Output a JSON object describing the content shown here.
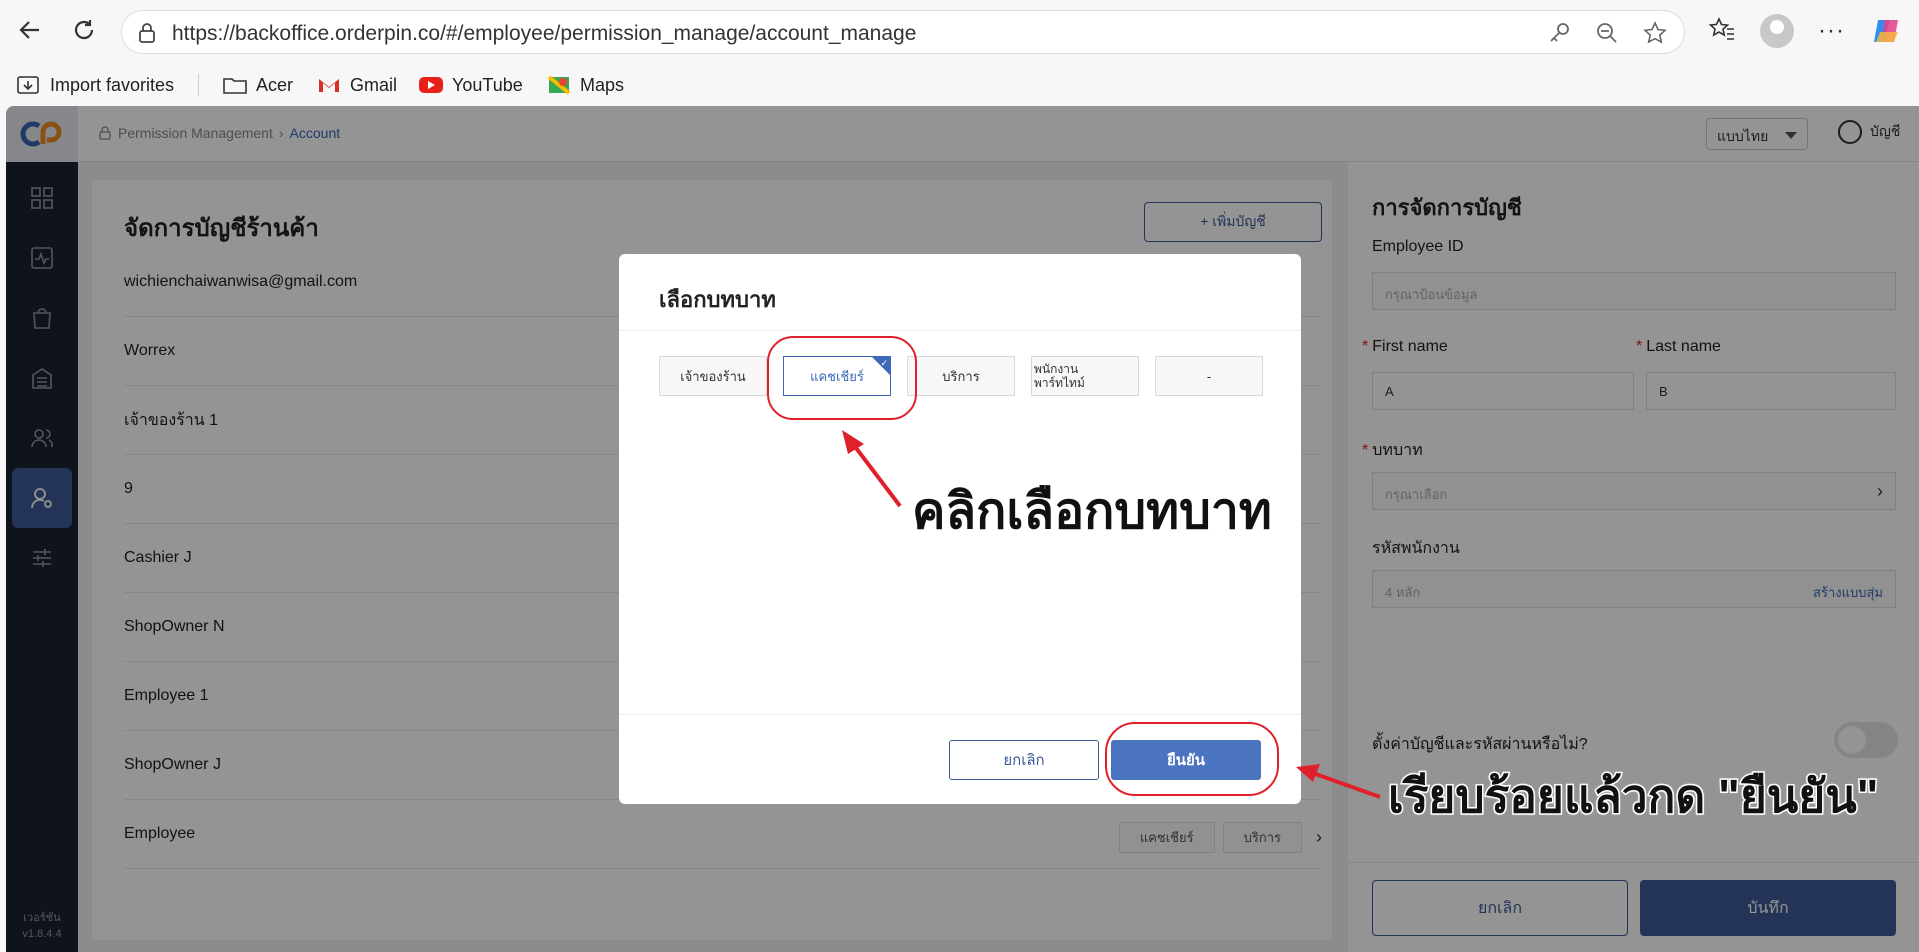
{
  "browser": {
    "url": "https://backoffice.orderpin.co/#/employee/permission_manage/account_manage",
    "bookmarks": [
      "Import favorites",
      "Acer",
      "Gmail",
      "YouTube",
      "Maps"
    ]
  },
  "app": {
    "breadcrumb": {
      "parent": "Permission Management",
      "current": "Account"
    },
    "language": "แบบไทย",
    "account_label": "บัญชี",
    "version": [
      "เวอร์ชัน",
      "v1.8.4.4"
    ]
  },
  "left_panel": {
    "title": "จัดการบัญชีร้านค้า",
    "add_button": "+ เพิ่มบัญชี",
    "accounts": [
      "wichienchaiwanwisa@gmail.com",
      "Worrex",
      "เจ้าของร้าน 1",
      "9",
      "Cashier J",
      "ShopOwner N",
      "Employee 1",
      "ShopOwner J",
      "Employee"
    ],
    "last_row_tags": [
      "แคชเชียร์",
      "บริการ"
    ]
  },
  "right_panel": {
    "title": "การจัดการบัญชี",
    "employee_id_label": "Employee ID",
    "employee_id_placeholder": "กรุณาป้อนข้อมูล",
    "first_name_label": "First name",
    "first_name_value": "A",
    "last_name_label": "Last name",
    "last_name_value": "B",
    "role_label": "บทบาท",
    "role_placeholder": "กรุณาเลือก",
    "pin_label": "รหัสพนักงาน",
    "pin_placeholder": "4 หลัก",
    "pin_generate": "สร้างแบบสุ่ม",
    "setup_label": "ตั้งค่าบัญชีและรหัสผ่านหรือไม่?",
    "cancel": "ยกเลิก",
    "save": "บันทึก"
  },
  "modal": {
    "title": "เลือกบทบาท",
    "roles": [
      {
        "label": "เจ้าของร้าน",
        "selected": false
      },
      {
        "label": "แคชเชียร์",
        "selected": true
      },
      {
        "label": "บริการ",
        "selected": false
      },
      {
        "label": "พนักงาน\nพาร์ทไทม์",
        "selected": false
      },
      {
        "label": "-",
        "selected": false
      }
    ],
    "cancel": "ยกเลิก",
    "confirm": "ยืนยัน"
  },
  "annotations": {
    "select_role": "คลิกเลือกบทบาท",
    "confirm_hint": "เรียบร้อยแล้วกด \"ยืนยัน\""
  },
  "colors": {
    "primary": "#3d5b98",
    "sidebar": "#1b2431",
    "annotation": "#e0202a"
  }
}
